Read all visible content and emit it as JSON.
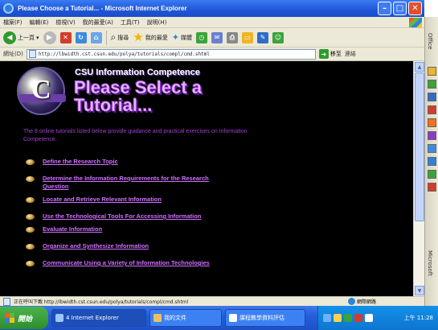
{
  "window": {
    "title": "Please Choose a Tutorial... - Microsoft Internet Explorer"
  },
  "menu": [
    "檔案(F)",
    "編輯(E)",
    "檢視(V)",
    "我的最愛(A)",
    "工具(T)",
    "說明(H)"
  ],
  "toolbar": {
    "back_label": "上一頁",
    "search_label": "搜尋",
    "favorites_label": "我的最愛",
    "media_label": "媒體"
  },
  "address": {
    "label": "網址(D)",
    "url": "http://lbwidth.cst.csun.edu/polya/tutorials/compl/cmd.shtml",
    "go_label": "移至",
    "links_label": "連結"
  },
  "page": {
    "site_title": "CSU Information Competence",
    "heading_line1": "Please Select a",
    "heading_line2": "Tutorial...",
    "intro": "The 8 online tutorials listed below provide guidance and practical exercises on Information Competence.",
    "links": [
      "Define the Research Topic",
      "Determine the Information Requirements for the Research Question",
      "Locate and Retrieve Relevant Information",
      "Use the Technological Tools For Accessing Information",
      "Evaluate Information",
      "Organize and Synthesize Information",
      "Communicate Using a Variety of Information Technologies"
    ]
  },
  "status": {
    "text": "正在呼叫下載 http://lbwidth.cst.csun.edu/polya/tutorials/compl/cmd.shtml",
    "zone": "網際網路"
  },
  "sidepanel": {
    "office_label": "Office",
    "ms_label": "Microsoft"
  },
  "taskbar": {
    "start_label": "開始",
    "tasks": [
      "4 Internet Explorer",
      "我的文件",
      "課程教學資料評估"
    ],
    "clock": "上午 11:28"
  },
  "colors": {
    "accent": "#d070ff",
    "heading": "#e8b6ff",
    "intro": "#a040d0"
  }
}
